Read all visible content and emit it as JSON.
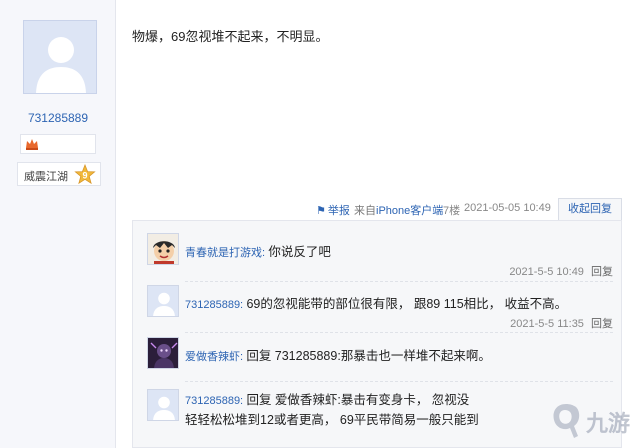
{
  "post": {
    "author": {
      "uid": "731285889",
      "rank_title": "威震江湖",
      "rank_level": "9"
    },
    "content": "物爆，69忽视堆不起来，不明显。",
    "meta": {
      "report": "举报",
      "source_prefix": "来自",
      "source_device": "iPhone客户端",
      "floor": "7楼",
      "time": "2021-05-05 10:49",
      "collapse_label": "收起回复"
    }
  },
  "replies": [
    {
      "author": "青春就是打游戏:",
      "text": "你说反了吧",
      "time": "2021-5-5 10:49",
      "reply_label": "回复"
    },
    {
      "author": "731285889:",
      "text": "69的忽视能带的部位很有限， 跟89 115相比， 收益不高。",
      "time": "2021-5-5 11:35",
      "reply_label": "回复"
    },
    {
      "author": "爱做香辣虾:",
      "prefix": "回复",
      "target": "731285889",
      "text": ":那暴击也一样堆不起来啊。"
    },
    {
      "author": "731285889:",
      "prefix": "回复",
      "target": "爱做香辣虾",
      "text": ":暴击有变身卡， 忽视没",
      "text2": "轻轻松松堆到12或者更高， 69平民带简易一般只能到"
    }
  ],
  "watermark": {
    "text": "九游"
  },
  "colors": {
    "link": "#2d64b3",
    "panel": "#f6f7f9",
    "avatar_bg": "#dfe6f6"
  }
}
